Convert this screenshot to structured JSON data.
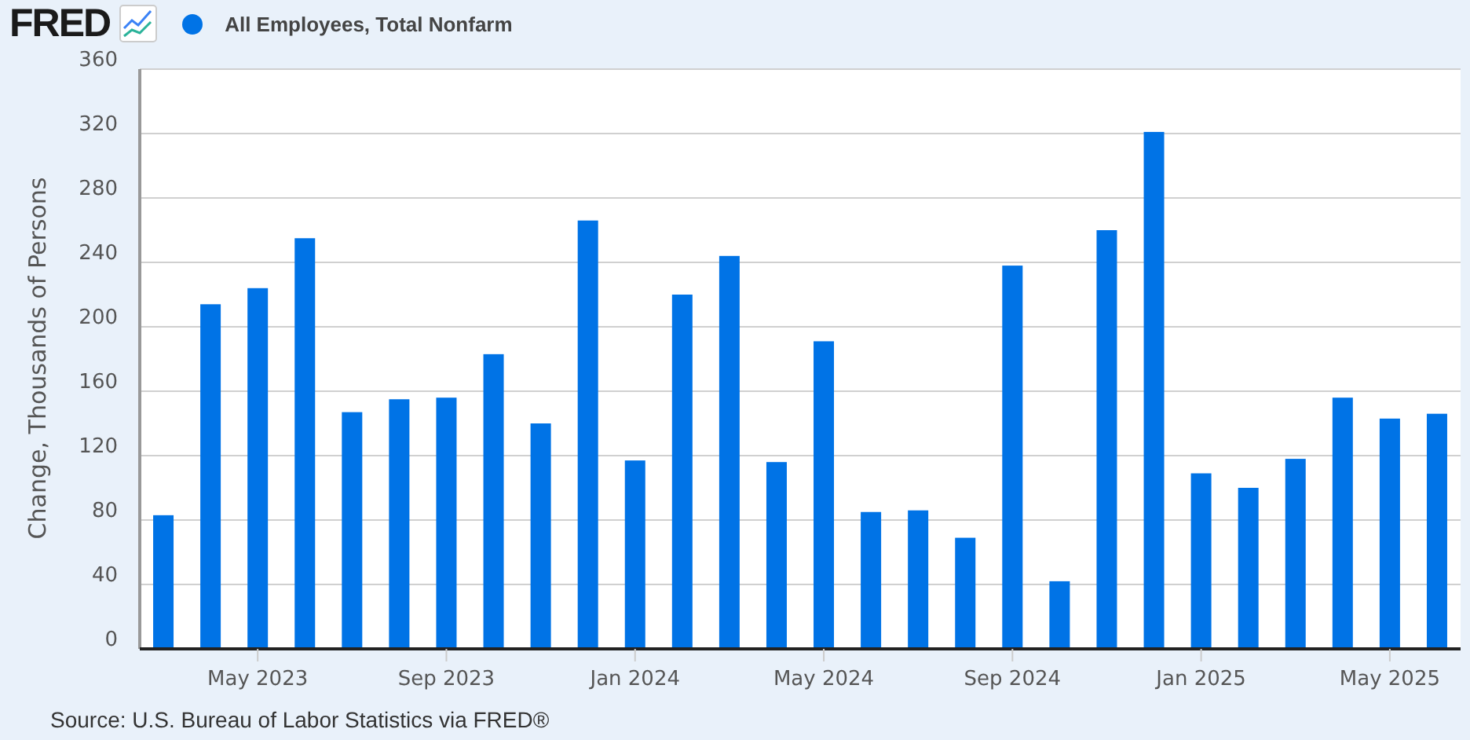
{
  "header": {
    "logo": "FRED"
  },
  "chart_data": {
    "type": "bar",
    "ylabel": "Change, Thousands of Persons",
    "ylim": [
      0,
      360
    ],
    "yticks": [
      0,
      40,
      80,
      120,
      160,
      200,
      240,
      280,
      320,
      360
    ],
    "grid": true,
    "categories": [
      null,
      null,
      "May 2023",
      null,
      null,
      null,
      "Sep 2023",
      null,
      null,
      null,
      "Jan 2024",
      null,
      null,
      null,
      "May 2024",
      null,
      null,
      null,
      "Sep 2024",
      null,
      null,
      null,
      "Jan 2025",
      null,
      null,
      null,
      "May 2025",
      null
    ],
    "series": [
      {
        "name": "All Employees, Total Nonfarm",
        "color": "#0073e6",
        "values": [
          83,
          214,
          224,
          255,
          147,
          155,
          156,
          183,
          140,
          266,
          117,
          220,
          244,
          116,
          191,
          85,
          86,
          69,
          238,
          42,
          260,
          321,
          109,
          100,
          118,
          156,
          143,
          146
        ]
      }
    ]
  },
  "source": "Source: U.S. Bureau of Labor Statistics via FRED®"
}
